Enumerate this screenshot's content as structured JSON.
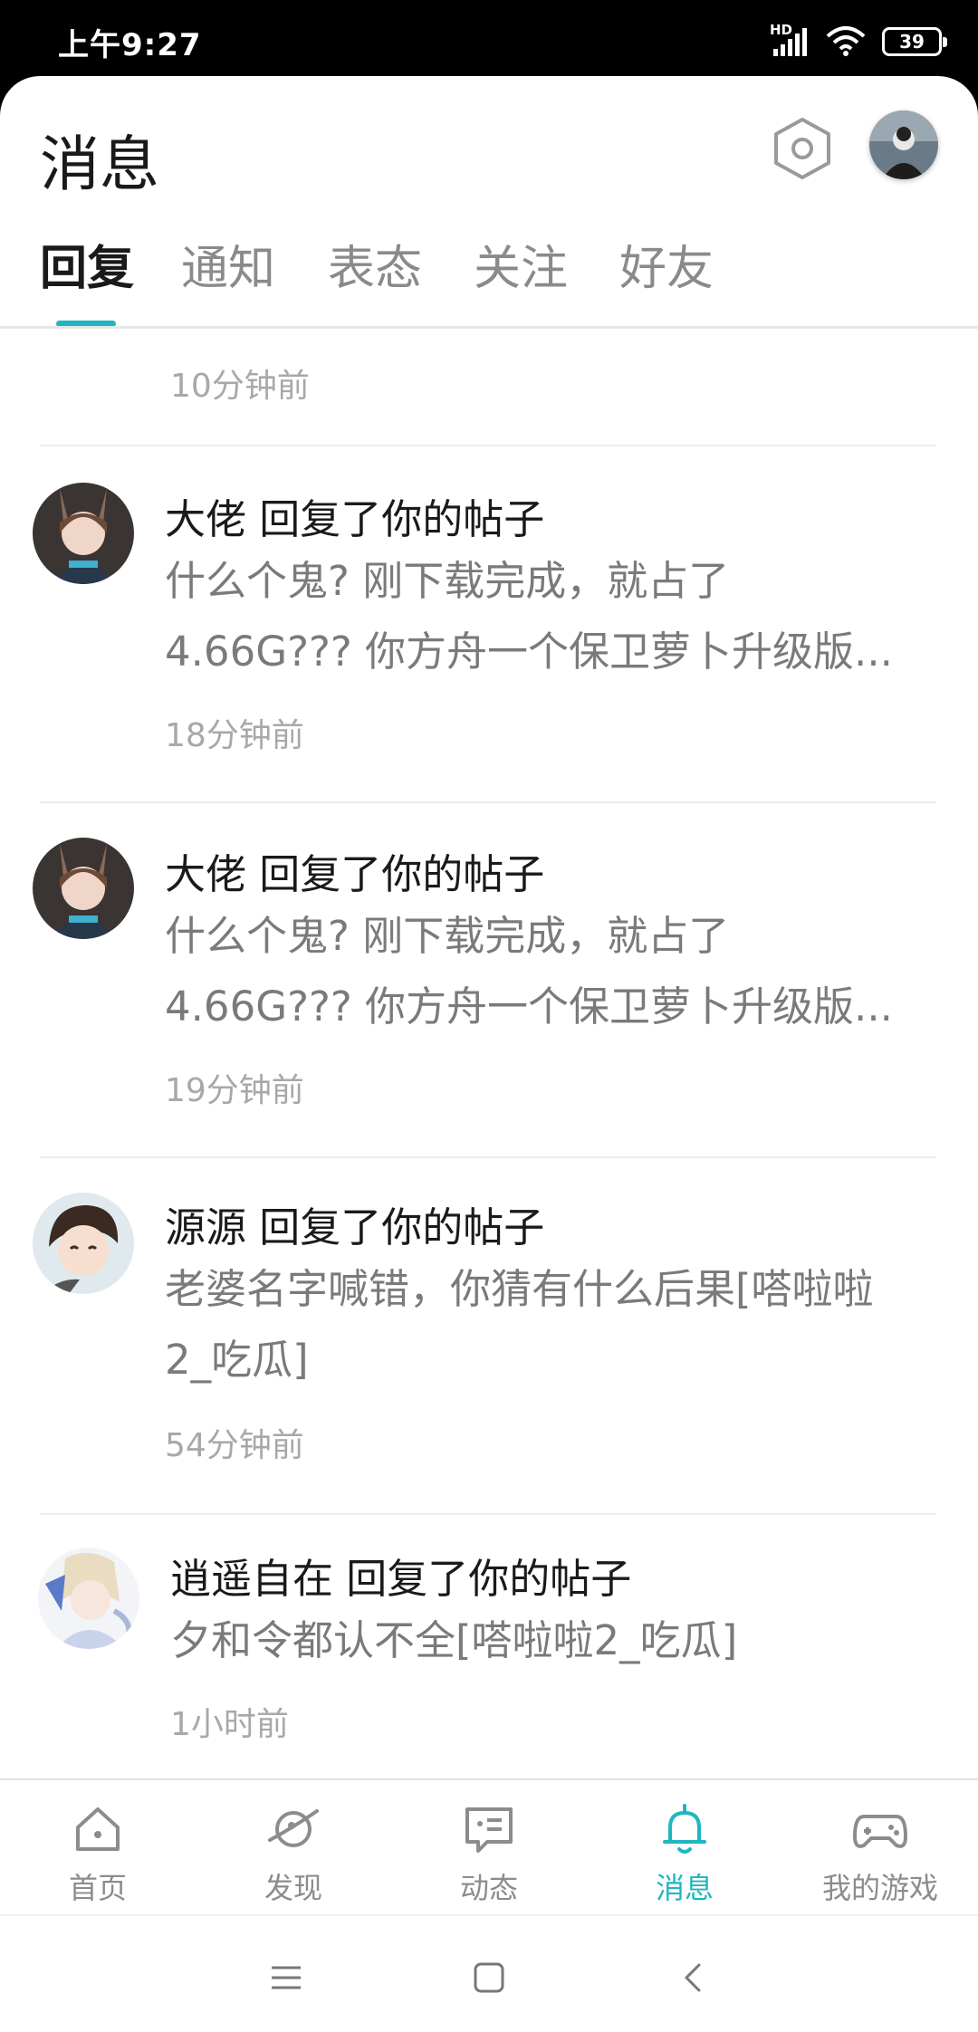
{
  "status_bar": {
    "time": "上午9:27",
    "network_label": "HD",
    "battery": "39",
    "icons": [
      "signal-icon",
      "wifi-icon",
      "battery-icon"
    ]
  },
  "header": {
    "title": "消息",
    "settings_icon": "hexagon-settings-icon",
    "profile_avatar": "user-avatar"
  },
  "tabs": [
    {
      "label": "回复",
      "active": true
    },
    {
      "label": "通知",
      "active": false
    },
    {
      "label": "表态",
      "active": false
    },
    {
      "label": "关注",
      "active": false
    },
    {
      "label": "好友",
      "active": false
    }
  ],
  "messages": {
    "top_partial_time": "10分钟前",
    "items": [
      {
        "user": "大佬",
        "action": "回复了你的帖子",
        "title": "大佬 回复了你的帖子",
        "body_line1": "什么个鬼? 刚下载完成，就占了",
        "body_line2": "4.66G??? 你方舟一个保卫萝卜升级版...",
        "time": "18分钟前"
      },
      {
        "user": "大佬",
        "action": "回复了你的帖子",
        "title": "大佬 回复了你的帖子",
        "body_line1": "什么个鬼? 刚下载完成，就占了",
        "body_line2": "4.66G??? 你方舟一个保卫萝卜升级版...",
        "time": "19分钟前"
      },
      {
        "user": "源源",
        "action": "回复了你的帖子",
        "title": "源源 回复了你的帖子",
        "body_line1": "老婆名字喊错，你猜有什么后果[嗒啦啦",
        "body_line2": "2_吃瓜]",
        "time": "54分钟前"
      },
      {
        "user": "逍遥自在",
        "action": "回复了你的帖子",
        "title": "逍遥自在 回复了你的帖子",
        "body_line1": "夕和令都认不全[嗒啦啦2_吃瓜]",
        "body_line2": "",
        "time": "1小时前"
      }
    ]
  },
  "bottom_nav": [
    {
      "label": "首页",
      "icon": "home-icon",
      "active": false
    },
    {
      "label": "发现",
      "icon": "planet-icon",
      "active": false
    },
    {
      "label": "动态",
      "icon": "chat-bubble-icon",
      "active": false
    },
    {
      "label": "消息",
      "icon": "bell-icon",
      "active": true
    },
    {
      "label": "我的游戏",
      "icon": "gamepad-icon",
      "active": false
    }
  ],
  "colors": {
    "accent": "#1fb6c0",
    "title_text": "#1a1a1a",
    "body_text": "#7a7a7a",
    "muted_text": "#a8a8a8"
  }
}
